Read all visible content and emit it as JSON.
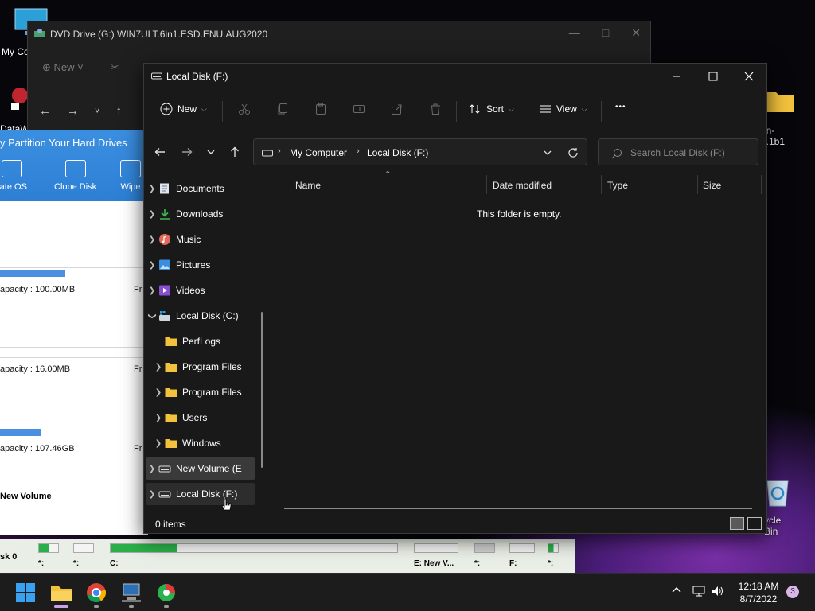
{
  "desktop": {
    "icon_my_computer": "My Co",
    "icon_datawork": "DataW",
    "icon_right_label": "en-1.1b1",
    "recycle_label": "ycle Bin"
  },
  "dvd_window": {
    "title": "DVD Drive (G:) WIN7ULT.6in1.ESD.ENU.AUG2020",
    "new_label": "New"
  },
  "partition_app": {
    "headline": "y Partition Your Hard Drives",
    "tools": [
      "rate OS",
      "Clone Disk",
      "Wipe"
    ],
    "rows": [
      {
        "capacity": "apacity : 100.00MB",
        "free": "Fr"
      },
      {
        "capacity": "apacity : 16.00MB",
        "free": "Fr"
      },
      {
        "capacity": "apacity : 107.46GB",
        "free": "Fr"
      }
    ],
    "volume_label": "New Volume",
    "disk_label": "sk 0",
    "map_slots": [
      "*:",
      "*:",
      "C:",
      "E: New V...",
      "*:",
      "F:",
      "*:"
    ]
  },
  "explorer": {
    "title": "Local Disk (F:)",
    "commands": {
      "new": "New",
      "sort": "Sort",
      "view": "View",
      "more": "•••"
    },
    "breadcrumb": [
      "My Computer",
      "Local Disk (F:)"
    ],
    "search_placeholder": "Search Local Disk (F:)",
    "tree": [
      {
        "label": "Documents"
      },
      {
        "label": "Downloads"
      },
      {
        "label": "Music"
      },
      {
        "label": "Pictures"
      },
      {
        "label": "Videos"
      },
      {
        "label": "Local Disk (C:)"
      },
      {
        "label": "PerfLogs"
      },
      {
        "label": "Program Files"
      },
      {
        "label": "Program Files"
      },
      {
        "label": "Users"
      },
      {
        "label": "Windows"
      },
      {
        "label": "New Volume (E"
      },
      {
        "label": "Local Disk (F:)"
      }
    ],
    "columns": [
      "Name",
      "Date modified",
      "Type",
      "Size"
    ],
    "empty_message": "This folder is empty.",
    "status": "0 items"
  },
  "taskbar": {
    "time": "12:18 AM",
    "date": "8/7/2022",
    "notification_count": "3"
  },
  "colors": {
    "explorer_bg": "#191919",
    "folder_yellow": "#f3c23c",
    "accent_blue": "#2d7fd4",
    "taskbar_bg": "#1c1c1c"
  }
}
